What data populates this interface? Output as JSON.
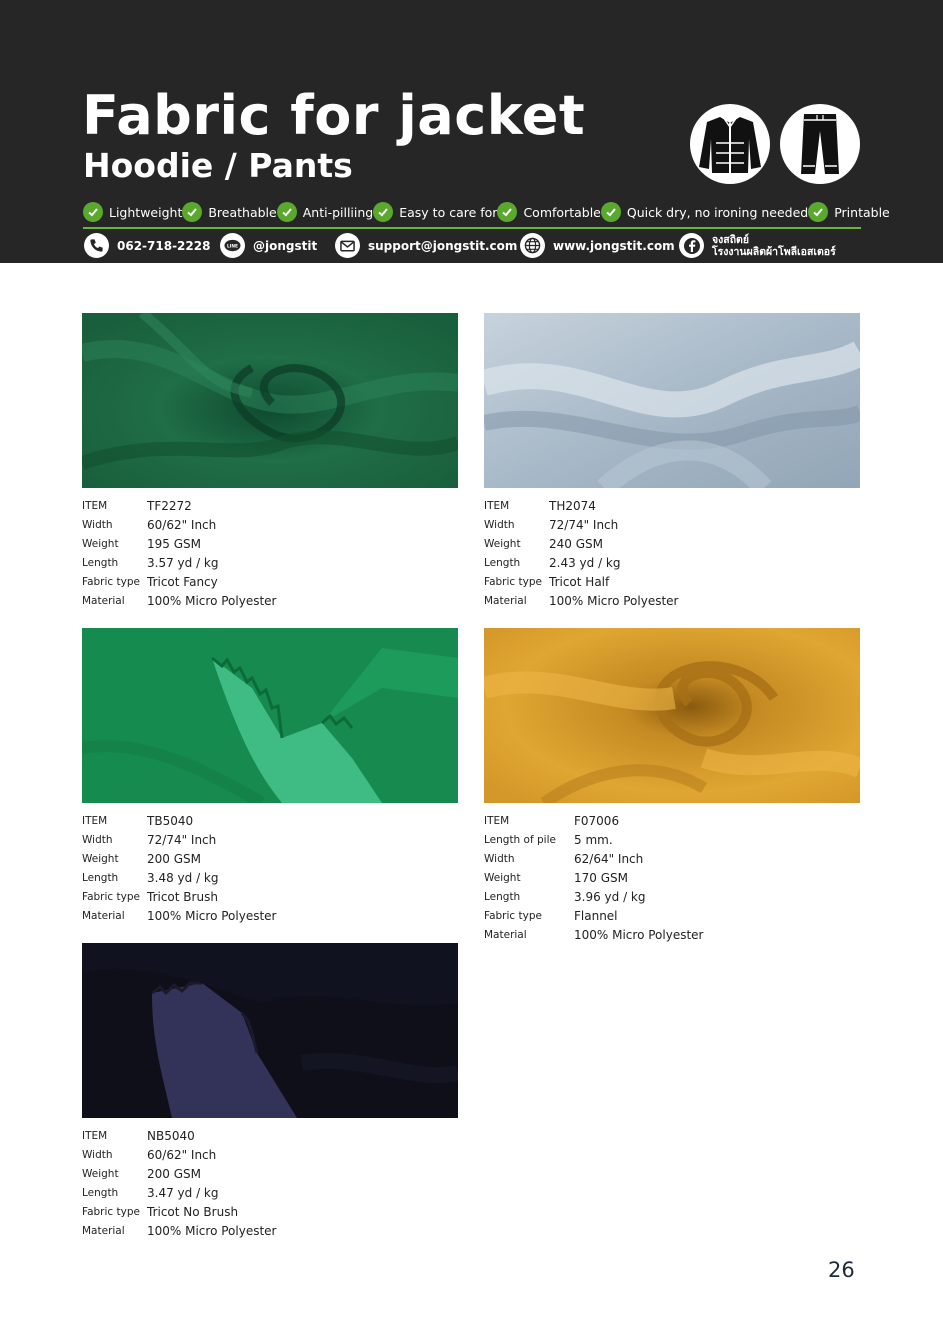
{
  "header": {
    "title": "Fabric for jacket",
    "subtitle": "Hoodie / Pants",
    "type_icons": [
      "jacket-icon",
      "pants-icon"
    ],
    "features": [
      "Lightweight",
      "Breathable",
      "Anti-pilliing",
      "Easy to care for",
      "Comfortable",
      "Quick dry, no ironing needed",
      "Printable"
    ],
    "contacts": {
      "phone": "062-718-2228",
      "line": "@jongstit",
      "email": "support@jongstit.com",
      "website": "www.jongstit.com",
      "facebook_line1": "จงสถิตย์",
      "facebook_line2": "โรงงานผลิตผ้าโพลีเอสเตอร์"
    },
    "colors": {
      "background": "#262626",
      "accent": "#6bb534",
      "check": "#5aa82e"
    }
  },
  "fabrics": [
    {
      "swatch_color": "#1e6b45",
      "specs": [
        {
          "label": "ITEM",
          "value": "TF2272"
        },
        {
          "label": "Width",
          "value": "60/62\" Inch"
        },
        {
          "label": "Weight",
          "value": "195 GSM"
        },
        {
          "label": "Length",
          "value": "3.57 yd / kg"
        },
        {
          "label": "Fabric type",
          "value": "Tricot Fancy"
        },
        {
          "label": "Material",
          "value": "100% Micro Polyester"
        }
      ]
    },
    {
      "swatch_color": "#9fb2c2",
      "specs": [
        {
          "label": "ITEM",
          "value": "TH2074"
        },
        {
          "label": "Width",
          "value": "72/74\" Inch"
        },
        {
          "label": "Weight",
          "value": "240 GSM"
        },
        {
          "label": "Length",
          "value": "2.43 yd / kg"
        },
        {
          "label": "Fabric type",
          "value": "Tricot Half"
        },
        {
          "label": "Material",
          "value": "100% Micro Polyester"
        }
      ]
    },
    {
      "swatch_color": "#178a4f",
      "specs": [
        {
          "label": "ITEM",
          "value": "TB5040"
        },
        {
          "label": "Width",
          "value": "72/74\" Inch"
        },
        {
          "label": "Weight",
          "value": "200 GSM"
        },
        {
          "label": "Length",
          "value": "3.48 yd / kg"
        },
        {
          "label": "Fabric type",
          "value": "Tricot Brush"
        },
        {
          "label": "Material",
          "value": "100% Micro Polyester"
        }
      ]
    },
    {
      "swatch_color": "#d99d2a",
      "specs": [
        {
          "label": "ITEM",
          "value": "F07006"
        },
        {
          "label": "Length of pile",
          "value": "5 mm."
        },
        {
          "label": "Width",
          "value": "62/64\" Inch"
        },
        {
          "label": "Weight",
          "value": "170 GSM"
        },
        {
          "label": "Length",
          "value": "3.96 yd / kg"
        },
        {
          "label": "Fabric type",
          "value": "Flannel"
        },
        {
          "label": "Material",
          "value": "100% Micro Polyester"
        }
      ]
    },
    {
      "swatch_color": "#0e0f18",
      "specs": [
        {
          "label": "ITEM",
          "value": "NB5040"
        },
        {
          "label": "Width",
          "value": "60/62\" Inch"
        },
        {
          "label": "Weight",
          "value": "200 GSM"
        },
        {
          "label": "Length",
          "value": "3.47 yd / kg"
        },
        {
          "label": "Fabric type",
          "value": "Tricot No Brush"
        },
        {
          "label": "Material",
          "value": "100% Micro Polyester"
        }
      ]
    }
  ],
  "page_number": "26"
}
